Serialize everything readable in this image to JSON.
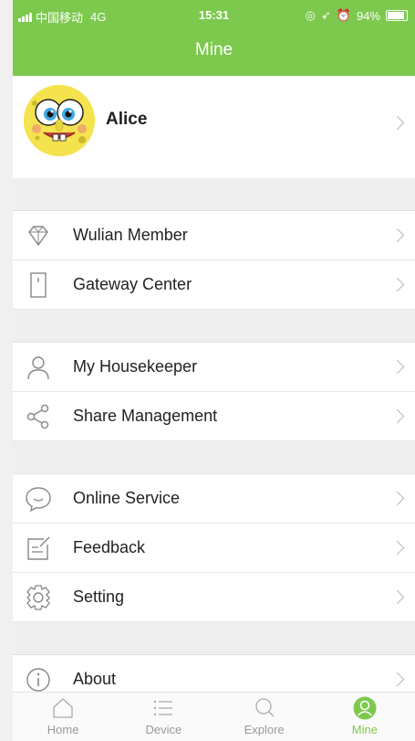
{
  "status": {
    "carrier": "中国移动",
    "network": "4G",
    "time": "15:31",
    "battery": "94%"
  },
  "header": {
    "title": "Mine"
  },
  "profile": {
    "name": "Alice"
  },
  "menu": {
    "group1": [
      {
        "label": "Wulian Member",
        "icon": "diamond-icon"
      },
      {
        "label": "Gateway Center",
        "icon": "gateway-icon"
      }
    ],
    "group2": [
      {
        "label": "My Housekeeper",
        "icon": "person-icon"
      },
      {
        "label": "Share Management",
        "icon": "share-icon"
      }
    ],
    "group3": [
      {
        "label": "Online Service",
        "icon": "chat-icon"
      },
      {
        "label": "Feedback",
        "icon": "edit-icon"
      },
      {
        "label": "Setting",
        "icon": "gear-icon"
      }
    ],
    "group4": [
      {
        "label": "About",
        "icon": "info-icon"
      }
    ]
  },
  "tabs": [
    {
      "label": "Home",
      "icon": "home-icon",
      "active": false
    },
    {
      "label": "Device",
      "icon": "list-icon",
      "active": false
    },
    {
      "label": "Explore",
      "icon": "search-icon",
      "active": false
    },
    {
      "label": "Mine",
      "icon": "user-icon",
      "active": true
    }
  ],
  "colors": {
    "accent": "#7cc94e",
    "inactive": "#999999"
  }
}
